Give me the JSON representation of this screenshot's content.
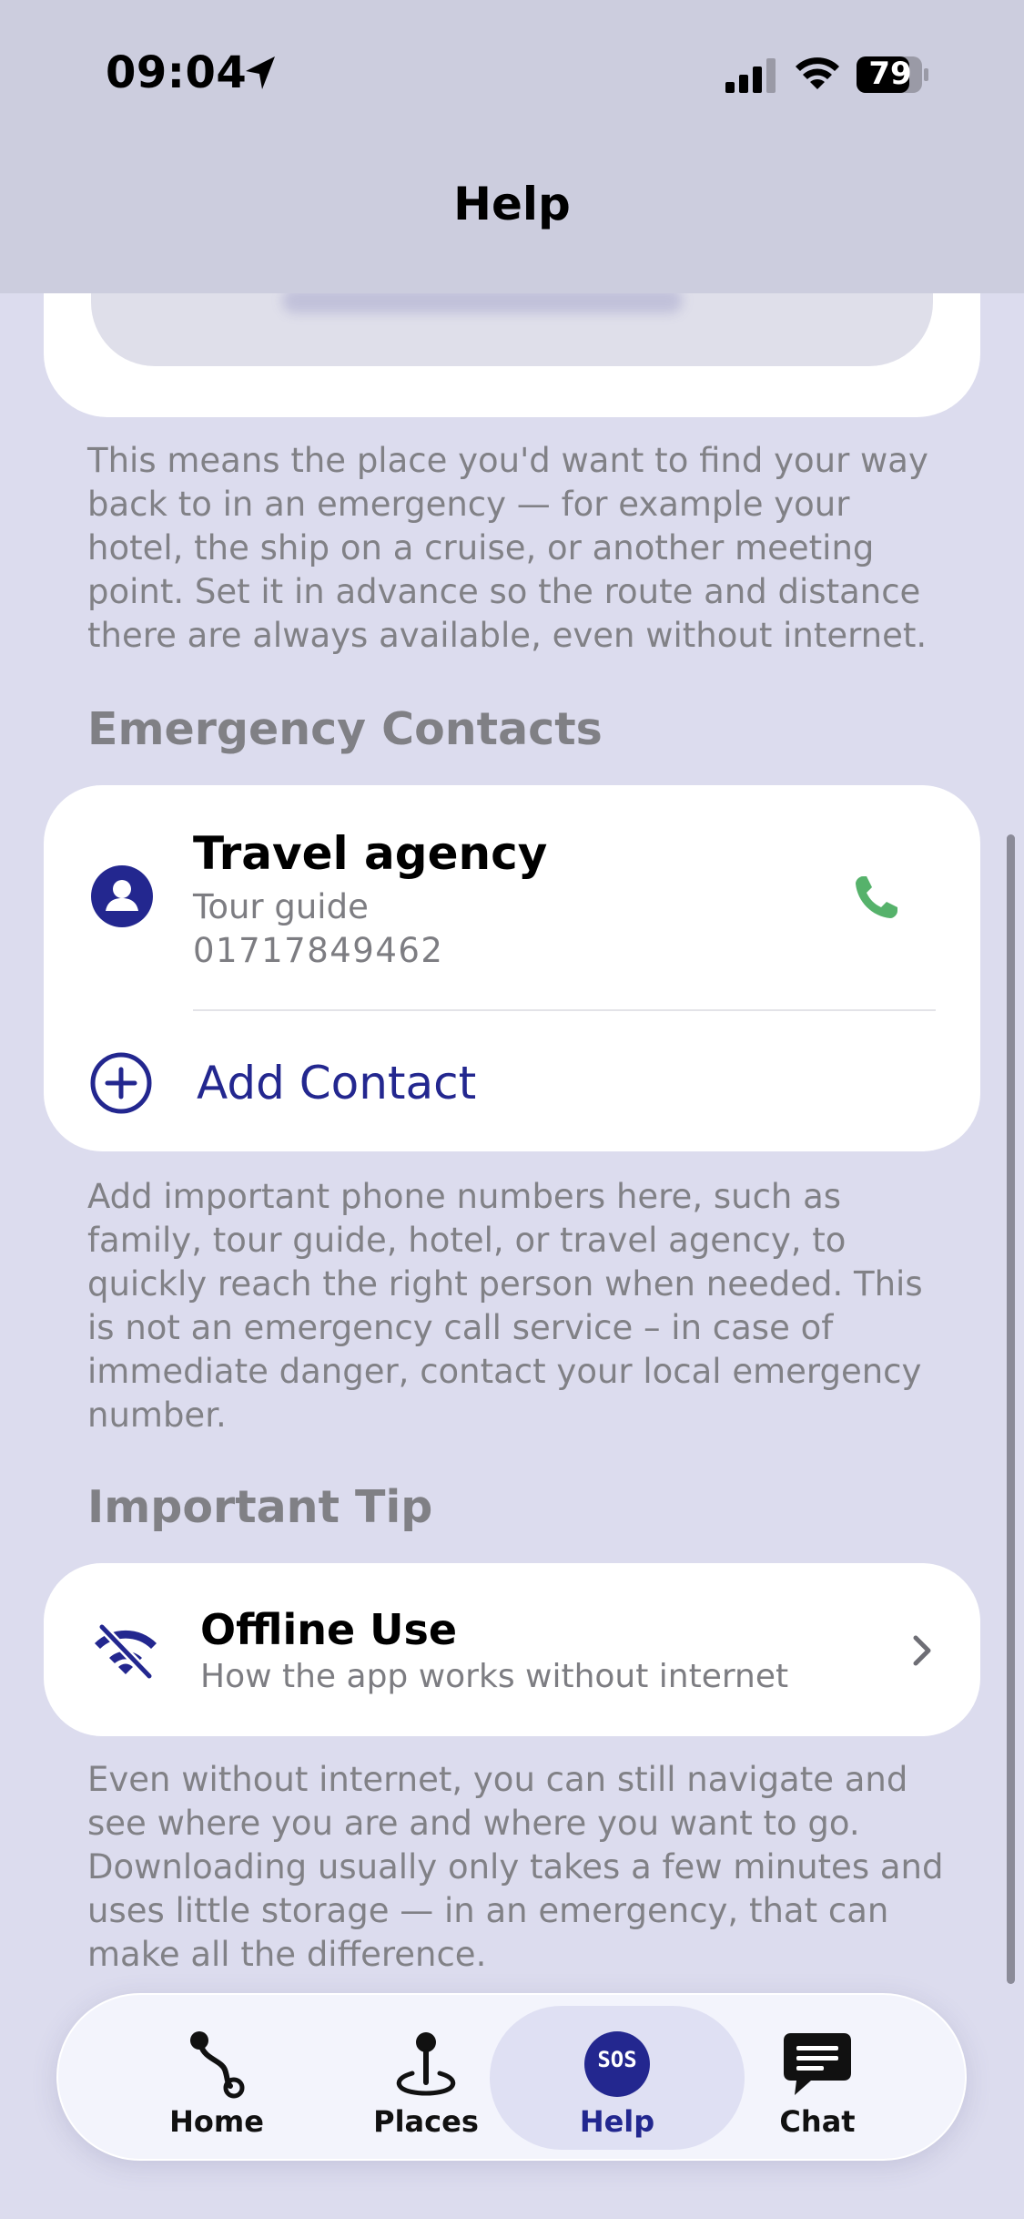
{
  "status_bar": {
    "time": "09:04",
    "battery": "79"
  },
  "header": {
    "title": "Help"
  },
  "safe_place": {
    "description": "This means the place you'd want to find your way back to in an emergency — for example your hotel, the ship on a cruise, or another meeting point. Set it in advance so the route and distance there are always available, even without internet."
  },
  "emergency_contacts": {
    "heading": "Emergency Contacts",
    "contacts": [
      {
        "name": "Travel agency",
        "role": "Tour guide",
        "phone": "01717849462"
      }
    ],
    "add_label": "Add Contact",
    "description": "Add important phone numbers here, such as family, tour guide, hotel, or travel agency, to quickly reach the right person when needed. This is not an emergency call service – in case of immediate danger, contact your local emergency number."
  },
  "important_tip": {
    "heading": "Important Tip",
    "title": "Offline Use",
    "subtitle": "How the app works without internet",
    "description": "Even without internet, you can still navigate and see where you are and where you want to go. Downloading usually only takes a few minutes and uses little storage — in an emergency, that can make all the difference."
  },
  "tab_bar": {
    "tabs": [
      {
        "label": "Home",
        "icon": "route-icon"
      },
      {
        "label": "Places",
        "icon": "pin-icon"
      },
      {
        "label": "Help",
        "icon": "sos-icon",
        "badge": "SOS",
        "active": true
      },
      {
        "label": "Chat",
        "icon": "chat-icon"
      }
    ]
  },
  "colors": {
    "accent": "#23278f",
    "call_green": "#56b26b",
    "background": "#dcdcee",
    "header": "#cccdde"
  }
}
